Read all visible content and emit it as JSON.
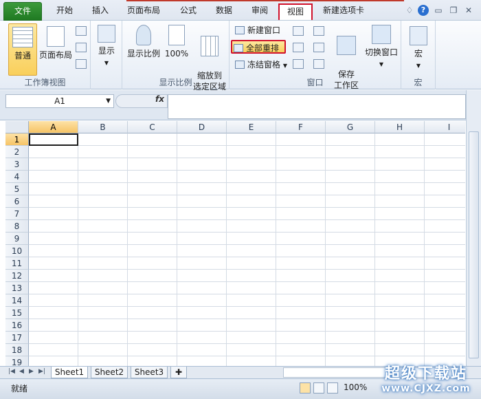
{
  "tabs": [
    "文件",
    "开始",
    "插入",
    "页面布局",
    "公式",
    "数据",
    "审阅",
    "视图",
    "新建选项卡"
  ],
  "active_tab": "视图",
  "ribbon": {
    "workbook_views": {
      "label": "工作簿视图",
      "normal": "普通",
      "page_layout": "页面布局"
    },
    "show": {
      "label": "显示"
    },
    "zoom": {
      "label": "显示比例",
      "zoom": "显示比例",
      "hundred": "100%",
      "zoom_selection": "缩放到\n选定区域"
    },
    "window": {
      "label": "窗口",
      "new_window": "新建窗口",
      "arrange_all": "全部重排",
      "freeze_panes": "冻结窗格",
      "save_workspace": "保存\n工作区",
      "switch_windows": "切换窗口"
    },
    "macros": {
      "label": "宏",
      "macros": "宏"
    }
  },
  "formula_bar": {
    "name_box": "A1",
    "fx": "fx",
    "formula": ""
  },
  "columns": [
    "A",
    "B",
    "C",
    "D",
    "E",
    "F",
    "G",
    "H",
    "I"
  ],
  "rows": [
    "1",
    "2",
    "3",
    "4",
    "5",
    "6",
    "7",
    "8",
    "9",
    "10",
    "11",
    "12",
    "13",
    "14",
    "15",
    "16",
    "17",
    "18",
    "19"
  ],
  "sheets": [
    "Sheet1",
    "Sheet2",
    "Sheet3"
  ],
  "status": {
    "ready": "就绪",
    "zoom": "100%"
  },
  "watermark": {
    "line1": "超级下载站",
    "line2": "www.CJXZ.com"
  }
}
